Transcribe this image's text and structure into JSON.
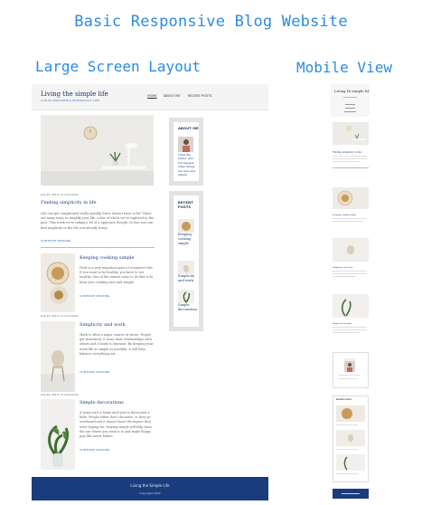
{
  "headings": {
    "main": "Basic Responsive Blog Website",
    "large": "Large Screen Layout",
    "mobile": "Mobile View"
  },
  "site": {
    "title": "Living the simple life",
    "tagline": "A BLOG EXPLORING MINIMALIST LIFE",
    "nav": [
      "HOME",
      "ABOUT ME",
      "RECENT POSTS"
    ]
  },
  "featured": {
    "meta": "July 23, 2019 | 3 comments",
    "title": "Finding simplicity in life",
    "body": "Life can get complicated really quickly, but it doesn't have to be! There are many ways to simplify your life, a few of which we've explored in the past. This week we're taking a bit of a approach though. In how you can find simplicity in the life you already living.",
    "more": "CONTINUE READING"
  },
  "posts": [
    {
      "title": "Keeping cooking simple",
      "body": "Food is a very important part of everyone's life. If you want to be healthy, you have to eat healthy. One of the easiest ways to do that is to keep your cooking nice and simple.",
      "more": "CONTINUE READING",
      "meta": "July 12, 2019 | 3 comments"
    },
    {
      "title": "Simplicity and work",
      "body": "Work is often a major source of stress. People get frustrated, it ruins their relationships with others and it leads to burnout. By keeping your work life as simple as possible, it will help balance everything out.",
      "more": "CONTINUE READING",
      "meta": "July 02, 2019 | 3 comments"
    },
    {
      "title": "Simple decorations",
      "body": "A home isn't a home until you've decorated a little. People either don't decorate, or they go overboard and it doesn't have the impact they were hoping for. Staying simple will help draw the eye where you want it to and make things pop like never before.",
      "more": "CONTINUE READING",
      "meta": ""
    }
  ],
  "sidebar": {
    "about_title": "ABOUT ME",
    "about_text": "I find life better, and I'm happier, when things are nice and simple.",
    "recent_title": "RECENT POSTS",
    "recent": [
      "Keeping cooking simple",
      "Simplicity and work",
      "Simple decorations"
    ]
  },
  "footer": {
    "line1": "Living the Simple Life",
    "line2": "Copyright 2022"
  },
  "mobile": {
    "title": "Living th simple lif",
    "post1": "Finding simplicity in life",
    "post2": "Keeping cooking simple",
    "post3": "Simplicity and work",
    "post4": "Simple decorations",
    "widget": "RECENT POSTS"
  },
  "colors": {
    "heading_blue": "#2b8be0",
    "footer_navy": "#1b3c7c",
    "widget_border": "#e2e2e2"
  }
}
